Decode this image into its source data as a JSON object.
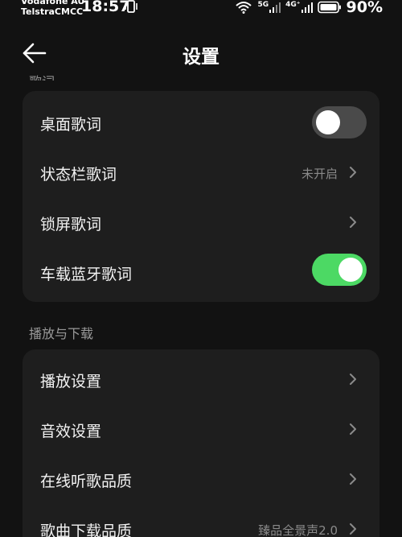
{
  "status_bar": {
    "carrier_line1": "Vodafone AU",
    "carrier_line2": "TelstraCMCC",
    "time": "18:57",
    "network": "5G",
    "network2": "4G⁺",
    "battery": "90%"
  },
  "header": {
    "title": "设置",
    "back_icon": "arrow-left-icon"
  },
  "sections": {
    "lyrics_partial_label": "歌词",
    "playback_label": "播放与下载"
  },
  "lyrics": {
    "items": [
      {
        "label": "桌面歌词",
        "control": "toggle",
        "state": "off"
      },
      {
        "label": "状态栏歌词",
        "value": "未开启",
        "control": "chevron"
      },
      {
        "label": "锁屏歌词",
        "control": "chevron"
      },
      {
        "label": "车载蓝牙歌词",
        "control": "toggle",
        "state": "on"
      }
    ]
  },
  "playback": {
    "items": [
      {
        "label": "播放设置",
        "control": "chevron"
      },
      {
        "label": "音效设置",
        "control": "chevron"
      },
      {
        "label": "在线听歌品质",
        "control": "chevron"
      },
      {
        "label": "歌曲下载品质",
        "value": "臻品全景声2.0",
        "control": "chevron"
      }
    ]
  },
  "colors": {
    "background": "#121212",
    "card": "#1e1e1e",
    "toggle_on": "#4cd964",
    "toggle_off": "#4a4a4a"
  }
}
